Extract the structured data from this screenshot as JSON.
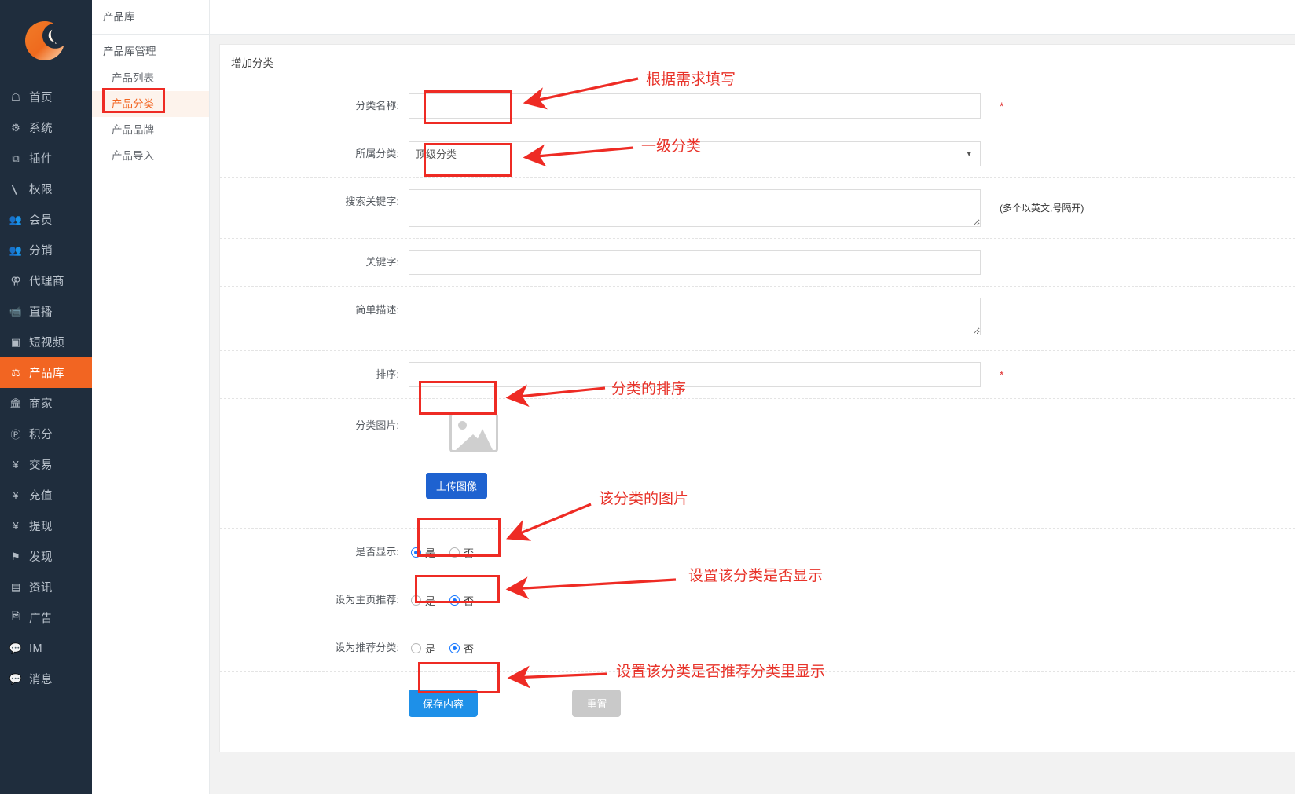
{
  "sidebar": {
    "logo_name": "brand-logo",
    "items": [
      {
        "icon": "home-icon",
        "glyph": "⌂",
        "label": "首页",
        "active": false
      },
      {
        "icon": "gear-icon",
        "glyph": "⚙",
        "label": "系统",
        "active": false
      },
      {
        "icon": "plugin-icon",
        "glyph": "⧉",
        "label": "插件",
        "active": false
      },
      {
        "icon": "sitemap-icon",
        "glyph": "⑂",
        "label": "权限",
        "active": false
      },
      {
        "icon": "users-icon",
        "glyph": "♟",
        "label": "会员",
        "active": false
      },
      {
        "icon": "users-icon",
        "glyph": "♟",
        "label": "分销",
        "active": false
      },
      {
        "icon": "agent-icon",
        "glyph": "⊚",
        "label": "代理商",
        "active": false
      },
      {
        "icon": "video-camera-icon",
        "glyph": "■",
        "label": "直播",
        "active": false
      },
      {
        "icon": "short-video-icon",
        "glyph": "▣",
        "label": "短视频",
        "active": false
      },
      {
        "icon": "product-library-icon",
        "glyph": "⚖",
        "label": "产品库",
        "active": true
      },
      {
        "icon": "bank-icon",
        "glyph": "ἽB",
        "label": "商家",
        "active": false
      },
      {
        "icon": "points-icon",
        "glyph": "Ⓟ",
        "label": "积分",
        "active": false
      },
      {
        "icon": "trade-icon",
        "glyph": "¥",
        "label": "交易",
        "active": false
      },
      {
        "icon": "recharge-icon",
        "glyph": "¥",
        "label": "充值",
        "active": false
      },
      {
        "icon": "withdraw-icon",
        "glyph": "¥",
        "label": "提现",
        "active": false
      },
      {
        "icon": "flag-icon",
        "glyph": "⚑",
        "label": "发现",
        "active": false
      },
      {
        "icon": "news-icon",
        "glyph": "▤",
        "label": "资讯",
        "active": false
      },
      {
        "icon": "image-icon",
        "glyph": "⛰",
        "label": "广告",
        "active": false
      },
      {
        "icon": "chat-icon",
        "glyph": "●",
        "label": "IM",
        "active": false
      },
      {
        "icon": "message-icon",
        "glyph": "●",
        "label": "消息",
        "active": false
      }
    ]
  },
  "subnav": {
    "title": "产品库",
    "group": "产品库管理",
    "items": [
      {
        "label": "产品列表",
        "active": false
      },
      {
        "label": "产品分类",
        "active": true
      },
      {
        "label": "产品品牌",
        "active": false
      },
      {
        "label": "产品导入",
        "active": false
      }
    ]
  },
  "panel": {
    "title": "增加分类"
  },
  "form": {
    "name": {
      "label": "分类名称:",
      "value": "",
      "placeholder": "",
      "required_mark": "*"
    },
    "parent": {
      "label": "所属分类:",
      "selected": "顶级分类",
      "options": [
        "顶级分类"
      ],
      "caret": "chevron-down-icon"
    },
    "search_keywords": {
      "label": "搜索关键字:",
      "value": "",
      "hint": "(多个以英文,号隔开)"
    },
    "keywords": {
      "label": "关键字:",
      "value": ""
    },
    "description": {
      "label": "简单描述:",
      "value": ""
    },
    "sort": {
      "label": "排序:",
      "value": "",
      "required_mark": "*"
    },
    "image": {
      "label": "分类图片:",
      "placeholder_icon": "image-placeholder-icon",
      "upload_button": "上传图像"
    },
    "is_show": {
      "label": "是否显示:",
      "options": [
        "是",
        "否"
      ],
      "selected": "是"
    },
    "home_recommend": {
      "label": "设为主页推荐:",
      "options": [
        "是",
        "否"
      ],
      "selected": "否"
    },
    "recommend_category": {
      "label": "设为推荐分类:",
      "options": [
        "是",
        "否"
      ],
      "selected": "否"
    },
    "actions": {
      "save": "保存内容",
      "reset": "重置"
    }
  },
  "annotations": [
    {
      "id": "anno-name",
      "text": "根据需求填写"
    },
    {
      "id": "anno-parent",
      "text": "一级分类"
    },
    {
      "id": "anno-sort",
      "text": "分类的排序"
    },
    {
      "id": "anno-image",
      "text": "该分类的图片"
    },
    {
      "id": "anno-show",
      "text": "设置该分类是否显示"
    },
    {
      "id": "anno-recommend",
      "text": "设置该分类是否推荐分类里显示"
    }
  ],
  "colors": {
    "sidebar_bg": "#1f2d3d",
    "accent": "#f26522",
    "annotation": "#e8332a",
    "primary_button": "#1e90e8",
    "upload_button": "#1e62d0",
    "reset_button": "#c9c9c9",
    "radio_checked": "#1677ff"
  }
}
